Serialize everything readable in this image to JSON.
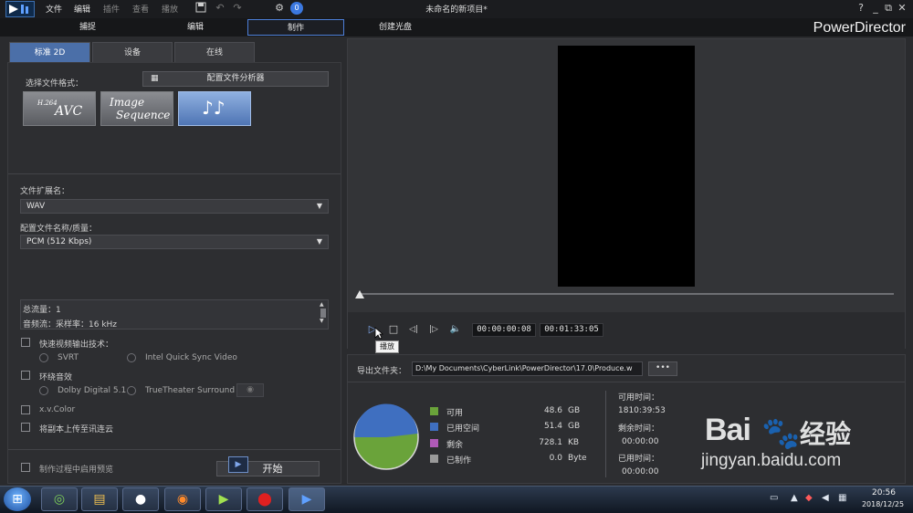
{
  "menu": {
    "items": [
      "文件",
      "编辑",
      "插件",
      "查看",
      "播放"
    ],
    "dim": [
      false,
      false,
      true,
      true,
      true
    ]
  },
  "window": {
    "title": "未命名的新项目*",
    "help": "?",
    "minimize": "_",
    "restore": "⧉",
    "close": "✕"
  },
  "modes": {
    "capture": "捕捉",
    "edit": "编辑",
    "produce": "制作",
    "disc": "创建光盘"
  },
  "brand": "PowerDirector",
  "subtabs": {
    "standard2d": "标准 2D",
    "device": "设备",
    "online": "在线"
  },
  "format": {
    "label": "选择文件格式：",
    "profile_analyzer": "配置文件分析器",
    "avc_top": "H.264",
    "avc_main": "AVC",
    "image_seq_1": "Image",
    "image_seq_2": "Sequence",
    "audio_glyph": "♪♪"
  },
  "extension": {
    "label": "文件扩展名：",
    "value": "WAV",
    "arrow": "▼"
  },
  "profile": {
    "label": "配置文件名称/质量：",
    "value": "PCM (512 Kbps)",
    "arrow": "▼"
  },
  "info": {
    "line1": "总流量：1",
    "line2": "音频流：采样率：16 kHz"
  },
  "options": {
    "fast_tech": "快速视频输出技术：",
    "svrt": "SVRT",
    "intel": "Intel Quick Sync Video",
    "surround": "环绕音效",
    "dolby": "Dolby Digital 5.1",
    "truetheater": "TrueTheater Surround",
    "xvcolor": "x.v.Color",
    "upload": "将副本上传至讯连云",
    "preview_during": "制作过程中启用预览"
  },
  "start_label": "开始",
  "playback": {
    "play": "▷",
    "stop": "□",
    "prev": "◁|",
    "next": "|▷",
    "volume": "🔈",
    "current": "00:00:00:08",
    "total": "00:01:33:05",
    "tooltip": "播放"
  },
  "output": {
    "folder_label": "导出文件夹：",
    "path": "D:\\My Documents\\CyberLink\\PowerDirector\\17.0\\Produce.w",
    "more": "•••"
  },
  "disk": {
    "items": [
      {
        "label": "可用",
        "value": "48.6",
        "unit": "GB",
        "color": "#6aa33a"
      },
      {
        "label": "已用空间",
        "value": "51.4",
        "unit": "GB",
        "color": "#3f6fc0"
      },
      {
        "label": "剩余",
        "value": "728.1",
        "unit": "KB",
        "color": "#b05ab8"
      },
      {
        "label": "已制作",
        "value": "0.0",
        "unit": "Byte",
        "color": "#9a9a9a"
      }
    ]
  },
  "times": {
    "available_label": "可用时间：",
    "available_value": "1810:39:53",
    "remaining_label": "剩余时间：",
    "remaining_value": "00:00:00",
    "elapsed_label": "已用时间：",
    "elapsed_value": "00:00:00"
  },
  "watermark": {
    "logo": "Bai",
    "logo_cn": "经验",
    "url": "jingyan.baidu.com"
  },
  "taskbar": {
    "time": "20:56",
    "date": "2018/12/25"
  }
}
